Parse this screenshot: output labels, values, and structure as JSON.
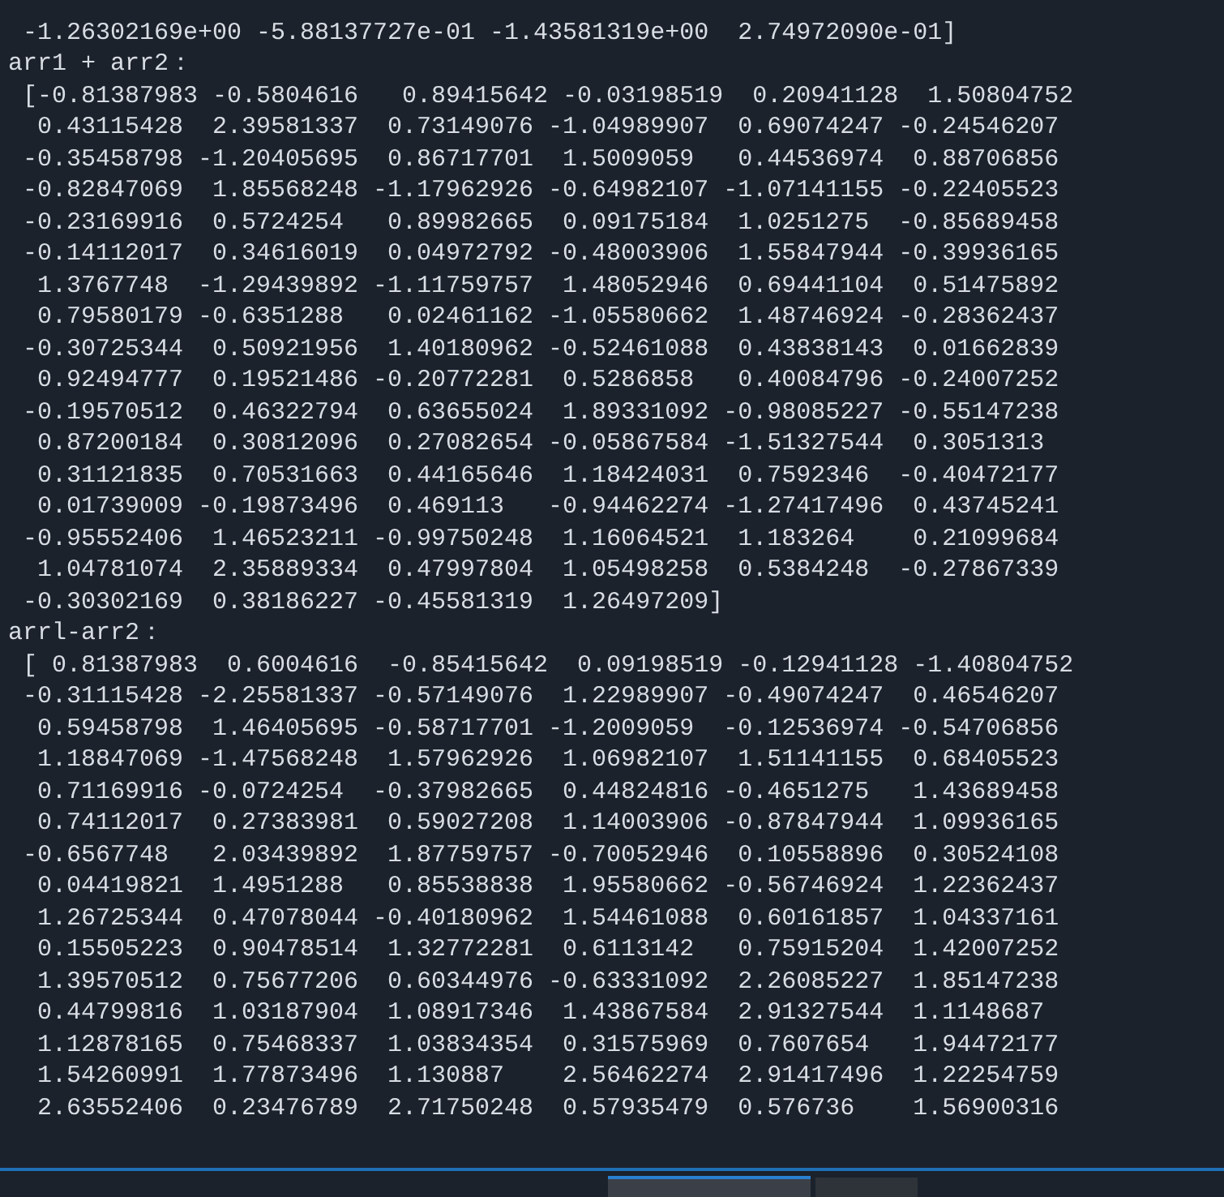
{
  "lines": [
    " -1.26302169e+00 -5.88137727e-01 -1.43581319e+00  2.74972090e-01]",
    "arr1 + arr2：",
    " [-0.81387983 -0.5804616   0.89415642 -0.03198519  0.20941128  1.50804752",
    "  0.43115428  2.39581337  0.73149076 -1.04989907  0.69074247 -0.24546207",
    " -0.35458798 -1.20405695  0.86717701  1.5009059   0.44536974  0.88706856",
    " -0.82847069  1.85568248 -1.17962926 -0.64982107 -1.07141155 -0.22405523",
    " -0.23169916  0.5724254   0.89982665  0.09175184  1.0251275  -0.85689458",
    " -0.14112017  0.34616019  0.04972792 -0.48003906  1.55847944 -0.39936165",
    "  1.3767748  -1.29439892 -1.11759757  1.48052946  0.69441104  0.51475892",
    "  0.79580179 -0.6351288   0.02461162 -1.05580662  1.48746924 -0.28362437",
    " -0.30725344  0.50921956  1.40180962 -0.52461088  0.43838143  0.01662839",
    "  0.92494777  0.19521486 -0.20772281  0.5286858   0.40084796 -0.24007252",
    " -0.19570512  0.46322794  0.63655024  1.89331092 -0.98085227 -0.55147238",
    "  0.87200184  0.30812096  0.27082654 -0.05867584 -1.51327544  0.3051313",
    "  0.31121835  0.70531663  0.44165646  1.18424031  0.7592346  -0.40472177",
    "  0.01739009 -0.19873496  0.469113   -0.94462274 -1.27417496  0.43745241",
    " -0.95552406  1.46523211 -0.99750248  1.16064521  1.183264    0.21099684",
    "  1.04781074  2.35889334  0.47997804  1.05498258  0.5384248  -0.27867339",
    " -0.30302169  0.38186227 -0.45581319  1.26497209]",
    "arrl-arr2：",
    " [ 0.81387983  0.6004616  -0.85415642  0.09198519 -0.12941128 -1.40804752",
    " -0.31115428 -2.25581337 -0.57149076  1.22989907 -0.49074247  0.46546207",
    "  0.59458798  1.46405695 -0.58717701 -1.2009059  -0.12536974 -0.54706856",
    "  1.18847069 -1.47568248  1.57962926  1.06982107  1.51141155  0.68405523",
    "  0.71169916 -0.0724254  -0.37982665  0.44824816 -0.4651275   1.43689458",
    "  0.74112017  0.27383981  0.59027208  1.14003906 -0.87847944  1.09936165",
    " -0.6567748   2.03439892  1.87759757 -0.70052946  0.10558896  0.30524108",
    "  0.04419821  1.4951288   0.85538838  1.95580662 -0.56746924  1.22362437",
    "  1.26725344  0.47078044 -0.40180962  1.54461088  0.60161857  1.04337161",
    "  0.15505223  0.90478514  1.32772281  0.6113142   0.75915204  1.42007252",
    "  1.39570512  0.75677206  0.60344976 -0.63331092  2.26085227  1.85147238",
    "  0.44799816  1.03187904  1.08917346  1.43867584  2.91327544  1.1148687",
    "  1.12878165  0.75468337  1.03834354  0.31575969  0.7607654   1.94472177",
    "  1.54260991  1.77873496  1.130887    2.56462274  2.91417496  1.22254759",
    "  2.63552406  0.23476789  2.71750248  0.57935479  0.576736    1.56900316"
  ],
  "bottom_panel": {
    "tabs": [
      {
        "selected": true
      },
      {
        "selected": false
      }
    ]
  }
}
